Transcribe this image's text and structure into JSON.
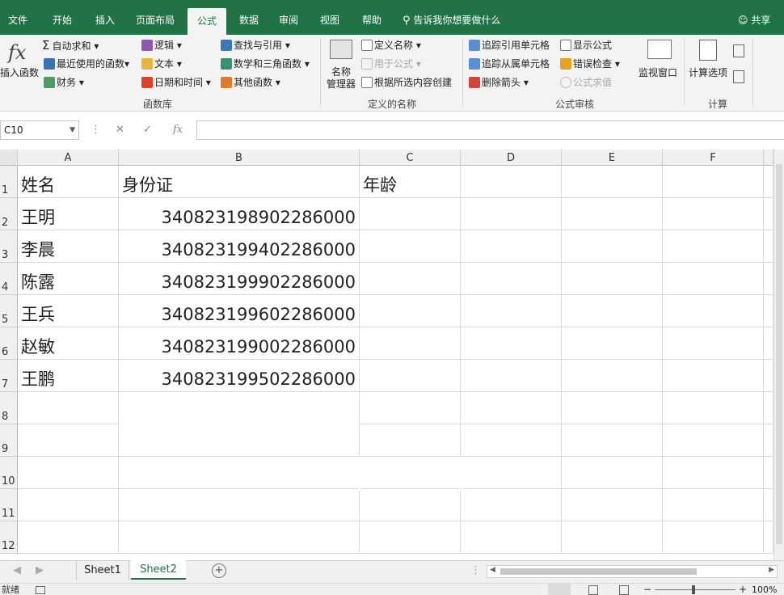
{
  "tabs": [
    {
      "label": "文件"
    },
    {
      "label": "开始"
    },
    {
      "label": "插入"
    },
    {
      "label": "页面布局"
    },
    {
      "label": "公式"
    },
    {
      "label": "数据"
    },
    {
      "label": "审阅"
    },
    {
      "label": "视图"
    },
    {
      "label": "帮助"
    }
  ],
  "tell_me": "告诉我你想要做什么",
  "share": "共享",
  "ribbon": {
    "insert_function": "插入函数",
    "autosum": "自动求和",
    "recent": "最近使用的函数",
    "finance": "财务",
    "logic": "逻辑",
    "text": "文本",
    "datetime": "日期和时间",
    "lookup": "查找与引用",
    "math": "数学和三角函数",
    "other": "其他函数",
    "group_library": "函数库",
    "name_manager": "名称\n管理器",
    "define_name": "定义名称",
    "use_in_formula": "用于公式",
    "create_from_selection": "根据所选内容创建",
    "group_names": "定义的名称",
    "trace_precedents": "追踪引用单元格",
    "trace_dependents": "追踪从属单元格",
    "remove_arrows": "删除箭头",
    "show_formulas": "显示公式",
    "error_checking": "错误检查",
    "evaluate_formula": "公式求值",
    "watch_window": "监视窗口",
    "group_auditing": "公式审核",
    "calc_options": "计算选项",
    "group_calc": "计算"
  },
  "formula_bar": {
    "name_box": "C10",
    "formula": "",
    "fx": "fx"
  },
  "columns": [
    "A",
    "B",
    "C",
    "D",
    "E",
    "F"
  ],
  "rows": [
    "1",
    "2",
    "3",
    "4",
    "5",
    "6",
    "7",
    "8",
    "9",
    "10",
    "11",
    "12"
  ],
  "cells": {
    "A1": "姓名",
    "B1": "身份证",
    "C1": "年龄",
    "A2": "王明",
    "B2": "340823198902286000",
    "A3": "李晨",
    "B3": "340823199402286000",
    "A4": "陈露",
    "B4": "340823199902286000",
    "A5": "王兵",
    "B5": "340823199602286000",
    "A6": "赵敏",
    "B6": "340823199002286000",
    "A7": "王鹏",
    "B7": "340823199502286000"
  },
  "sheets": [
    {
      "label": "Sheet1"
    },
    {
      "label": "Sheet2"
    }
  ],
  "status": {
    "ready": "就绪",
    "zoom": "100%"
  }
}
